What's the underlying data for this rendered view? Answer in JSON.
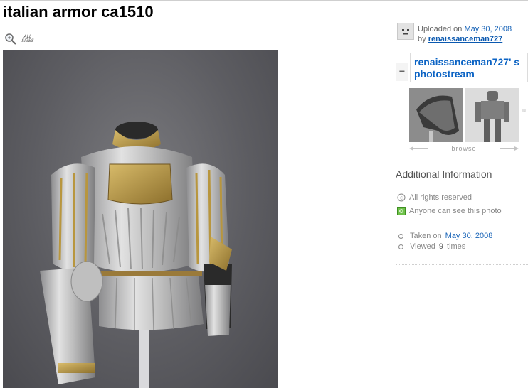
{
  "page": {
    "title": "italian armor ca1510",
    "all_sizes_label": "ALL\nSIZES"
  },
  "uploader": {
    "uploaded_prefix": "Uploaded on",
    "uploaded_date": "May 30, 2008",
    "by_prefix": "by",
    "username": "renaissanceman727"
  },
  "photostream": {
    "collapse_symbol": "−",
    "title": "renaissanceman727' s photostream",
    "thumbnails": [
      {
        "alt": "helmet-thumbnail"
      },
      {
        "alt": "armor-suit-thumbnail"
      }
    ],
    "browse_label": "browse",
    "more_hint": "u"
  },
  "additional_info": {
    "heading": "Additional Information",
    "rights": "All rights reserved",
    "visibility": "Anyone can see this photo",
    "taken_prefix": "Taken on",
    "taken_date": "May 30, 2008",
    "viewed_prefix": "Viewed",
    "viewed_count": "9",
    "viewed_suffix": "times"
  },
  "colors": {
    "link": "#1a65b8",
    "photo_bg": "#5d5d62",
    "gold": "#b8963e",
    "steel": "#c8c8c8"
  },
  "icons": [
    "zoom-icon",
    "copyright-icon",
    "public-icon",
    "bullet-icon",
    "arrow-left-icon",
    "arrow-right-icon"
  ]
}
